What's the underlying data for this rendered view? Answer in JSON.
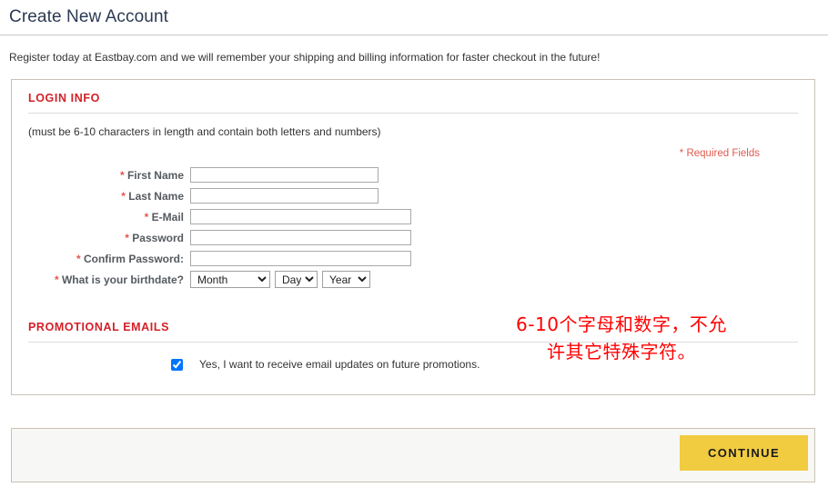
{
  "page": {
    "title": "Create New Account",
    "intro": "Register today at Eastbay.com and we will remember your shipping and billing information for faster checkout in the future!"
  },
  "login_section": {
    "heading": "LOGIN INFO",
    "note": "(must be 6-10 characters in length and contain both letters and numbers)",
    "required_fields_note": "* Required Fields",
    "annotation": {
      "line1": "6-10个字母和数字，不允",
      "line2": "许其它特殊字符。",
      "color": "#ff0000"
    },
    "fields": [
      {
        "star": "*",
        "label": "First Name",
        "value": "",
        "placeholder": ""
      },
      {
        "star": "*",
        "label": "Last Name",
        "value": "",
        "placeholder": ""
      },
      {
        "star": "*",
        "label": "E-Mail",
        "value": "",
        "placeholder": ""
      },
      {
        "star": "*",
        "label": "Password",
        "value": "",
        "placeholder": ""
      },
      {
        "star": "*",
        "label": "Confirm Password:",
        "value": "",
        "placeholder": ""
      },
      {
        "star": "*",
        "label": "What is your birthdate?",
        "value": "",
        "placeholder": ""
      }
    ],
    "birthdate": {
      "month": {
        "selected": "Month",
        "options": [
          "Month"
        ]
      },
      "day": {
        "selected": "Day",
        "options": [
          "Day"
        ]
      },
      "year": {
        "selected": "Year",
        "options": [
          "Year"
        ]
      }
    }
  },
  "promo_section": {
    "heading": "PROMOTIONAL EMAILS",
    "checkbox_label": "Yes, I want to receive email updates on future promotions.",
    "checkbox_checked": true
  },
  "footer": {
    "continue_label": "CONTINUE",
    "continue_color": "#f1cc41"
  }
}
